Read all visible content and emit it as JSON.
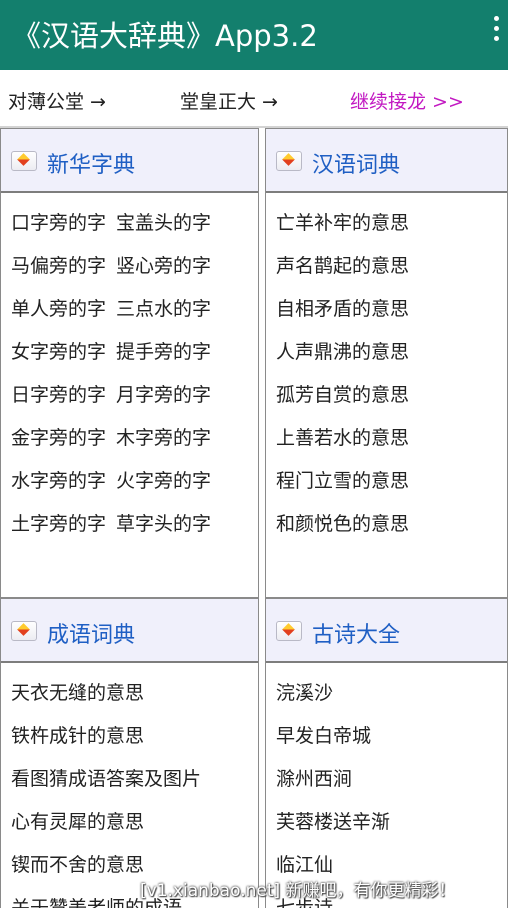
{
  "app": {
    "title": "《汉语大辞典》App3.2",
    "menu_icon": "overflow-menu-icon"
  },
  "chain": {
    "item1": "对薄公堂 →",
    "item2": "堂皇正大 →",
    "continue": "继续接龙 >>",
    "continue_color": "#c219c2"
  },
  "colors": {
    "appbar": "#137f6d",
    "section_title": "#1f5fc4",
    "section_header_bg": "#f0f0fb"
  },
  "sections": [
    {
      "title": "新华字典",
      "rows": [
        [
          "口字旁的字",
          "宝盖头的字"
        ],
        [
          "马偏旁的字",
          "竖心旁的字"
        ],
        [
          "单人旁的字",
          "三点水的字"
        ],
        [
          "女字旁的字",
          "提手旁的字"
        ],
        [
          "日字旁的字",
          "月字旁的字"
        ],
        [
          "金字旁的字",
          "木字旁的字"
        ],
        [
          "水字旁的字",
          "火字旁的字"
        ],
        [
          "土字旁的字",
          "草字头的字"
        ]
      ]
    },
    {
      "title": "汉语词典",
      "items": [
        "亡羊补牢的意思",
        "声名鹊起的意思",
        "自相矛盾的意思",
        "人声鼎沸的意思",
        "孤芳自赏的意思",
        "上善若水的意思",
        "程门立雪的意思",
        "和颜悦色的意思"
      ]
    },
    {
      "title": "成语词典",
      "items": [
        "天衣无缝的意思",
        "铁杵成针的意思",
        "看图猜成语答案及图片",
        "心有灵犀的意思",
        "锲而不舍的意思",
        "关于赞美老师的成语"
      ]
    },
    {
      "title": "古诗大全",
      "items": [
        "浣溪沙",
        "早发白帝城",
        "滁州西涧",
        "芙蓉楼送辛渐",
        "临江仙",
        "七步诗"
      ]
    }
  ],
  "watermark": "[v1.xianbao.net] 新赚吧，有你更精彩！"
}
